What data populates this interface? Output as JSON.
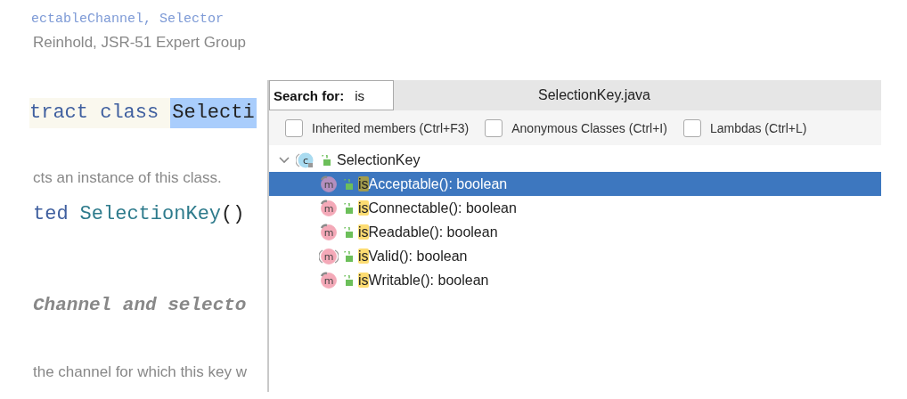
{
  "document": {
    "see_also": "ectableChannel, Selector",
    "author": "Reinhold, JSR-51 Expert Group",
    "declaration": {
      "keywords": "tract class",
      "name": "Selecti",
      "name_selected": true
    },
    "constructor_desc": "cts an instance of this class.",
    "constructor": {
      "modifier": "ted",
      "name": "SelectionKey",
      "parens": "()"
    },
    "section_heading": "Channel and selecto",
    "method_desc": "the channel for which this key w"
  },
  "popup": {
    "search_label": "Search for:",
    "search_value": "is",
    "file_title": "SelectionKey.java",
    "filters": [
      {
        "label": "Inherited members (Ctrl+F3)",
        "checked": false
      },
      {
        "label": "Anonymous Classes (Ctrl+I)",
        "checked": false
      },
      {
        "label": "Lambdas (Ctrl+L)",
        "checked": false
      }
    ],
    "tree": {
      "label": "SelectionKey",
      "icon": "c",
      "expanded": true,
      "children": [
        {
          "icon": "m",
          "kind": "final",
          "match": "is",
          "rest": "Acceptable(): boolean",
          "selected": true
        },
        {
          "icon": "m",
          "kind": "final",
          "match": "is",
          "rest": "Connectable(): boolean",
          "selected": false
        },
        {
          "icon": "m",
          "kind": "final",
          "match": "is",
          "rest": "Readable(): boolean",
          "selected": false
        },
        {
          "icon": "m",
          "kind": "abstract",
          "match": "is",
          "rest": "Valid(): boolean",
          "selected": false
        },
        {
          "icon": "m",
          "kind": "final",
          "match": "is",
          "rest": "Writable(): boolean",
          "selected": false
        }
      ]
    }
  }
}
